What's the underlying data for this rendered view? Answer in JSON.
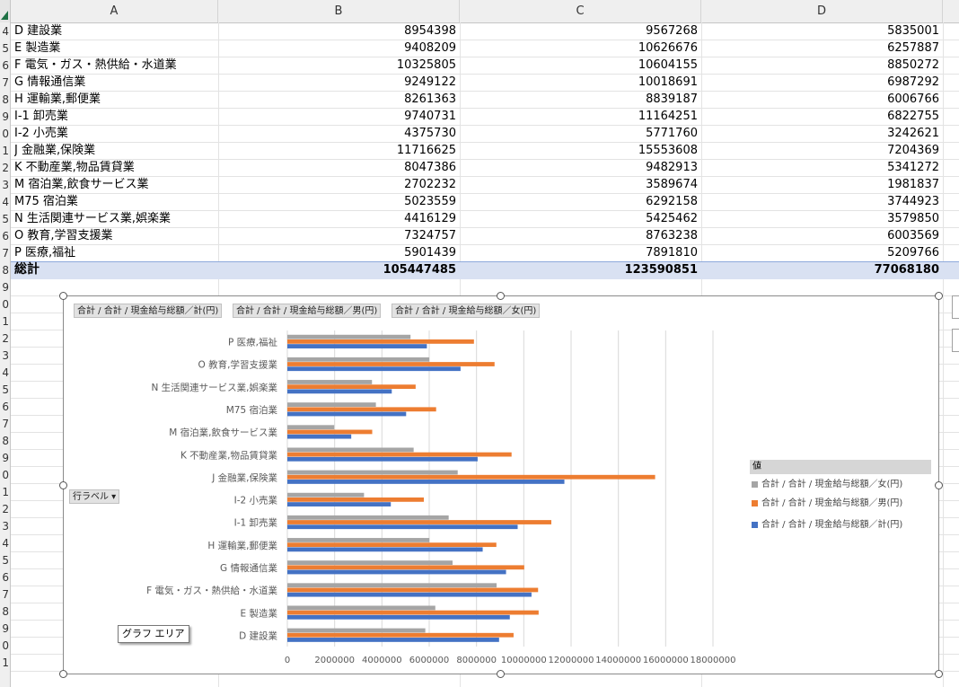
{
  "columns": [
    "A",
    "B",
    "C",
    "D"
  ],
  "rows": [
    {
      "num": "4",
      "label": "D 建設業",
      "b": "8954398",
      "c": "9567268",
      "d": "5835001"
    },
    {
      "num": "5",
      "label": "E 製造業",
      "b": "9408209",
      "c": "10626676",
      "d": "6257887"
    },
    {
      "num": "6",
      "label": "F 電気・ガス・熱供給・水道業",
      "b": "10325805",
      "c": "10604155",
      "d": "8850272"
    },
    {
      "num": "7",
      "label": "G 情報通信業",
      "b": "9249122",
      "c": "10018691",
      "d": "6987292"
    },
    {
      "num": "8",
      "label": "H 運輸業,郵便業",
      "b": "8261363",
      "c": "8839187",
      "d": "6006766"
    },
    {
      "num": "9",
      "label": "I-1 卸売業",
      "b": "9740731",
      "c": "11164251",
      "d": "6822755"
    },
    {
      "num": "0",
      "label": "I-2 小売業",
      "b": "4375730",
      "c": "5771760",
      "d": "3242621"
    },
    {
      "num": "1",
      "label": "J 金融業,保険業",
      "b": "11716625",
      "c": "15553608",
      "d": "7204369"
    },
    {
      "num": "2",
      "label": "K 不動産業,物品賃貸業",
      "b": "8047386",
      "c": "9482913",
      "d": "5341272"
    },
    {
      "num": "3",
      "label": "M 宿泊業,飲食サービス業",
      "b": "2702232",
      "c": "3589674",
      "d": "1981837"
    },
    {
      "num": "4",
      "label": "M75 宿泊業",
      "b": "5023559",
      "c": "6292158",
      "d": "3744923"
    },
    {
      "num": "5",
      "label": "N 生活関連サービス業,娯楽業",
      "b": "4416129",
      "c": "5425462",
      "d": "3579850"
    },
    {
      "num": "6",
      "label": "O 教育,学習支援業",
      "b": "7324757",
      "c": "8763238",
      "d": "6003569"
    },
    {
      "num": "7",
      "label": "P 医療,福祉",
      "b": "5901439",
      "c": "7891810",
      "d": "5209766"
    },
    {
      "num": "8",
      "label": "総計",
      "b": "105447485",
      "c": "123590851",
      "d": "77068180"
    }
  ],
  "empty_row_numbers": [
    "9",
    "0",
    "1",
    "2",
    "3",
    "4",
    "5",
    "6",
    "7",
    "8",
    "9",
    "0",
    "1",
    "2",
    "3",
    "4",
    "5",
    "6",
    "7",
    "8",
    "9",
    "0",
    "1"
  ],
  "chart": {
    "field_buttons": [
      "合計 / 合計 / 現金給与総額／計(円)",
      "合計 / 合計 / 現金給与総額／男(円)",
      "合計 / 合計 / 現金給与総額／女(円)"
    ],
    "row_label_button": "行ラベル ▾",
    "legend_title": "値",
    "tooltip": "グラフ エリア",
    "series_colors": {
      "female": "#a5a5a5",
      "male": "#ed7d31",
      "total": "#4472c4"
    }
  },
  "chart_data": {
    "type": "bar",
    "orientation": "horizontal",
    "categories": [
      "D 建設業",
      "E 製造業",
      "F 電気・ガス・熱供給・水道業",
      "G 情報通信業",
      "H 運輸業,郵便業",
      "I-1 卸売業",
      "I-2 小売業",
      "J 金融業,保険業",
      "K 不動産業,物品賃貸業",
      "M 宿泊業,飲食サービス業",
      "M75 宿泊業",
      "N 生活関連サービス業,娯楽業",
      "O 教育,学習支援業",
      "P 医療,福祉"
    ],
    "series": [
      {
        "name": "合計 / 合計 / 現金給与総額／女(円)",
        "values": [
          5835001,
          6257887,
          8850272,
          6987292,
          6006766,
          6822755,
          3242621,
          7204369,
          5341272,
          1981837,
          3744923,
          3579850,
          6003569,
          5209766
        ]
      },
      {
        "name": "合計 / 合計 / 現金給与総額／男(円)",
        "values": [
          9567268,
          10626676,
          10604155,
          10018691,
          8839187,
          11164251,
          5771760,
          15553608,
          9482913,
          3589674,
          6292158,
          5425462,
          8763238,
          7891810
        ]
      },
      {
        "name": "合計 / 合計 / 現金給与総額／計(円)",
        "values": [
          8954398,
          9408209,
          10325805,
          9249122,
          8261363,
          9740731,
          4375730,
          11716625,
          8047386,
          2702232,
          5023559,
          4416129,
          7324757,
          5901439
        ]
      }
    ],
    "xlim": [
      0,
      18000000
    ],
    "xticks": [
      "0",
      "2000000",
      "4000000",
      "6000000",
      "8000000",
      "10000000",
      "12000000",
      "14000000",
      "16000000",
      "18000000"
    ],
    "grid": true,
    "legend": "right"
  }
}
